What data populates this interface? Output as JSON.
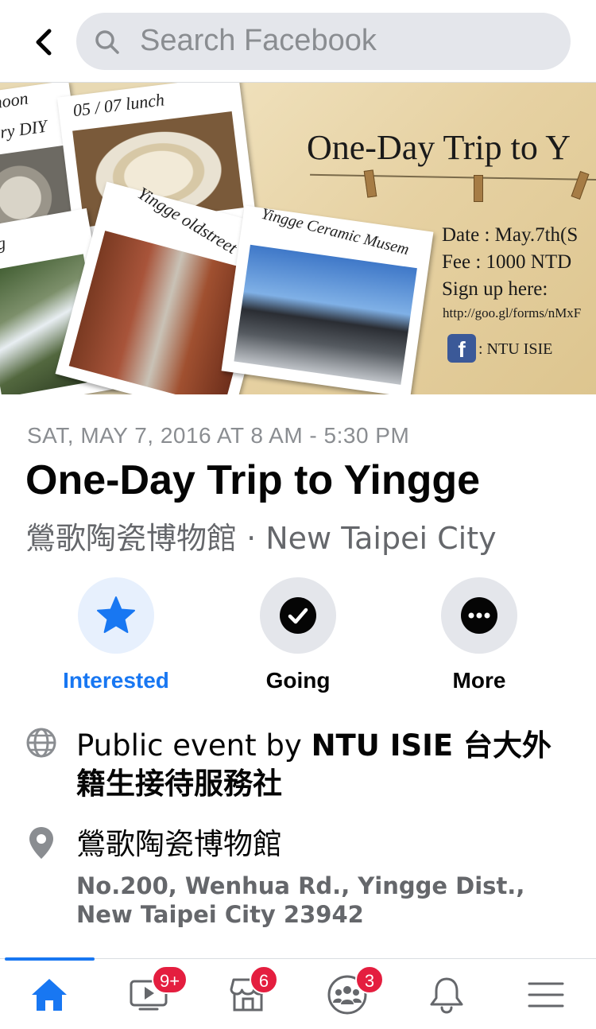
{
  "header": {
    "search_placeholder": "Search Facebook"
  },
  "cover": {
    "title": "One-Day Trip to Y",
    "photo_captions": [
      "rnoon",
      "tery DIY",
      "05 / 07  lunch",
      "ng",
      "Yingge oldstreet",
      "Yingge Ceramic Musem"
    ],
    "date_line": "Date : May.7th(S",
    "fee_line": "Fee : 1000 NTD",
    "signup_line": "Sign up here:",
    "url": "http://goo.gl/forms/nMxF",
    "fb_letter": "f",
    "fb_page": ": NTU ISIE"
  },
  "event": {
    "datetime": "SAT, MAY 7, 2016 AT 8 AM - 5:30 PM",
    "title": "One-Day Trip to Yingge",
    "location": "鶯歌陶瓷博物館 · New Taipei City"
  },
  "actions": [
    {
      "label": "Interested",
      "icon": "star-icon",
      "color": "#1877f2"
    },
    {
      "label": "Going",
      "icon": "check-circle-icon",
      "color": "#050505"
    },
    {
      "label": "More",
      "icon": "more-dots-icon",
      "color": "#050505"
    }
  ],
  "details": {
    "host_prefix": "Public event by ",
    "host_name": "NTU ISIE 台大外",
    "host_name_line2": "籍生接待服務社",
    "venue_name": "鶯歌陶瓷博物館",
    "venue_address": "No.200, Wenhua Rd., Yingge Dist., New Taipei City 23942"
  },
  "tabbar": {
    "tabs": [
      {
        "name": "home",
        "icon": "home-icon",
        "badge": ""
      },
      {
        "name": "watch",
        "icon": "video-icon",
        "badge": "9+"
      },
      {
        "name": "marketplace",
        "icon": "shop-icon",
        "badge": "6"
      },
      {
        "name": "groups",
        "icon": "groups-icon",
        "badge": "3"
      },
      {
        "name": "notifications",
        "icon": "bell-icon",
        "badge": ""
      },
      {
        "name": "menu",
        "icon": "menu-icon",
        "badge": ""
      }
    ]
  },
  "colors": {
    "accent": "#1877f2",
    "badge": "#e41e3f",
    "secondary_text": "#65676b"
  }
}
